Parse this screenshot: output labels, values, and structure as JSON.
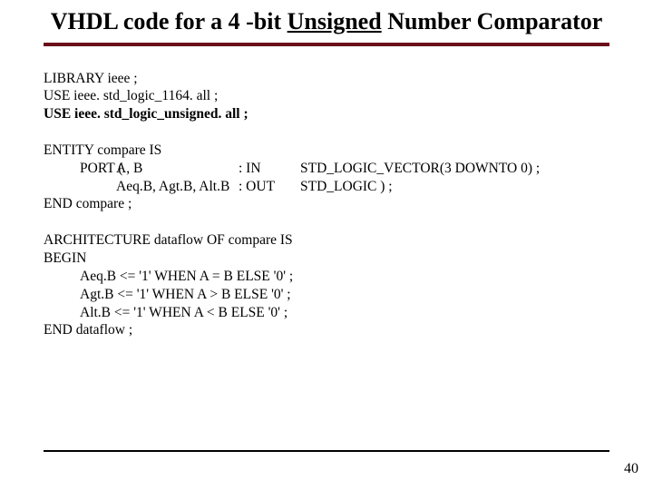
{
  "title": {
    "pre": "VHDL code for a 4 -bit ",
    "underlined": "Unsigned",
    "post": " Number Comparator"
  },
  "code": {
    "library": {
      "l1": "LIBRARY ieee ;",
      "l2": "USE ieee. std_logic_1164. all ;",
      "l3": "USE ieee. std_logic_unsigned. all ;"
    },
    "entity": {
      "head": "ENTITY compare IS",
      "port_kw": "PORT (",
      "row1": {
        "c1": "",
        "c2": "A, B",
        "c3": ": IN",
        "c4": "STD_LOGIC_VECTOR(3 DOWNTO 0) ;"
      },
      "row2": {
        "c1": "",
        "c2": "Aeq.B, Agt.B, Alt.B",
        "c3": ": OUT",
        "c4": "STD_LOGIC ) ;"
      },
      "end": "END compare ;"
    },
    "arch": {
      "l1": "ARCHITECTURE dataflow OF compare IS",
      "l2": "BEGIN",
      "l3": "Aeq.B <= '1' WHEN A = B ELSE '0' ;",
      "l4": "Agt.B <= '1' WHEN A > B ELSE '0' ;",
      "l5": "Alt.B <= '1' WHEN A < B ELSE '0' ;",
      "l6": "END dataflow ;"
    }
  },
  "page_number": "40"
}
